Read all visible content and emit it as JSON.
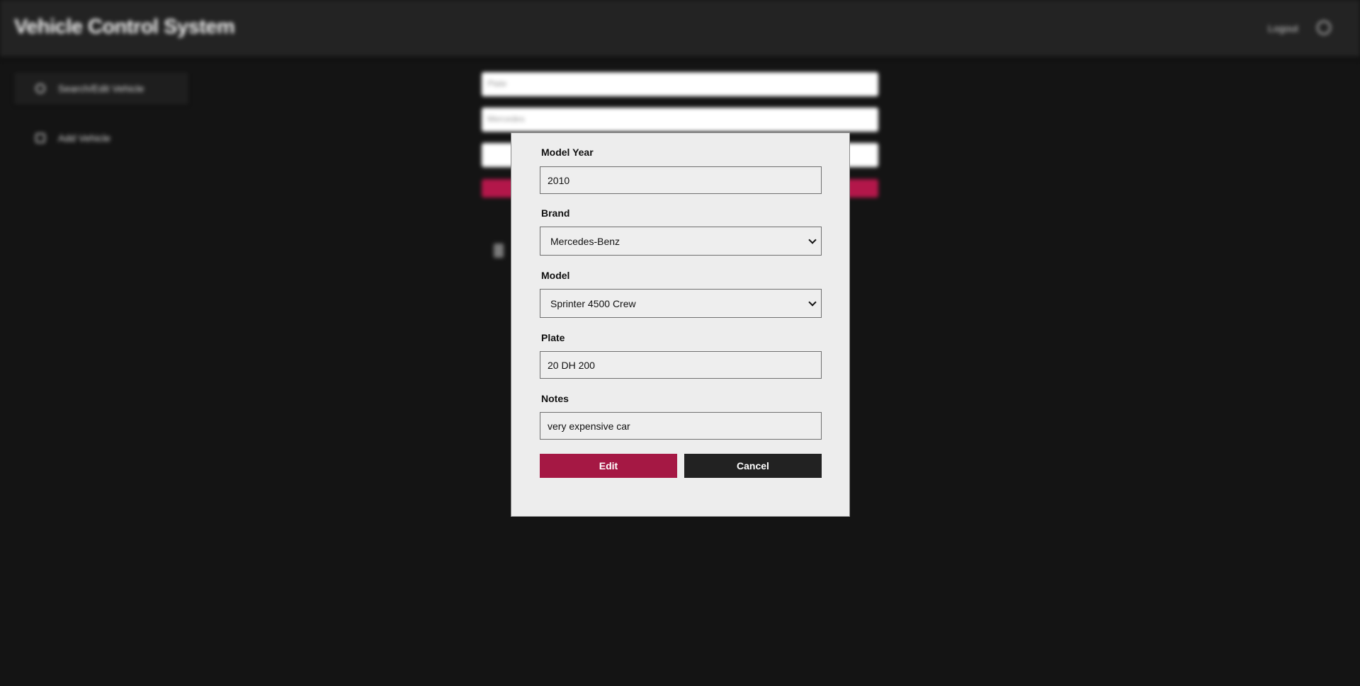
{
  "app": {
    "title": "Vehicle Control System",
    "logout_label": "Logout"
  },
  "sidebar": {
    "items": [
      {
        "label": "Search/Edit Vehicle",
        "icon": "search-icon"
      },
      {
        "label": "Add Vehicle",
        "icon": "add-vehicle-icon"
      }
    ]
  },
  "background_form": {
    "fields": [
      {
        "placeholder": "Plate"
      },
      {
        "placeholder": "Mercedes"
      },
      {
        "placeholder": ""
      }
    ]
  },
  "modal": {
    "model_year": {
      "label": "Model Year",
      "value": "2010"
    },
    "brand": {
      "label": "Brand",
      "value": "Mercedes-Benz"
    },
    "model": {
      "label": "Model",
      "value": "Sprinter 4500 Crew"
    },
    "plate": {
      "label": "Plate",
      "value": "20 DH 200"
    },
    "notes": {
      "label": "Notes",
      "value": "very expensive car"
    },
    "edit_label": "Edit",
    "cancel_label": "Cancel"
  },
  "colors": {
    "accent": "#a51844",
    "dark": "#222222",
    "modal_bg": "#ededed"
  }
}
